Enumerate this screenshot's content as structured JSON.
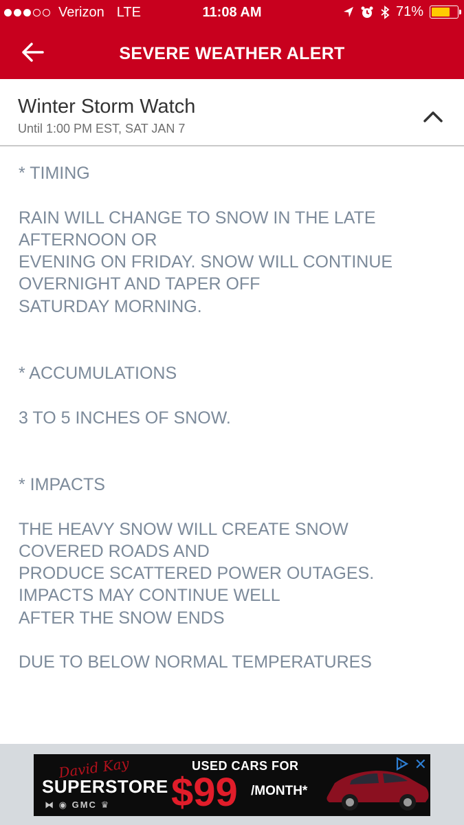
{
  "status_bar": {
    "carrier": "Verizon",
    "network": "LTE",
    "time": "11:08 AM",
    "battery": "71%",
    "battery_level": 0.71,
    "signal_bars_filled": 3,
    "signal_bars_total": 5
  },
  "nav": {
    "title": "SEVERE WEATHER ALERT",
    "back_icon": "arrow-left-icon"
  },
  "alert": {
    "title": "Winter Storm Watch",
    "subtitle": "Until 1:00 PM EST, SAT JAN 7",
    "toggle_icon": "chevron-up-icon"
  },
  "body": {
    "timing_heading": "* TIMING",
    "timing_lines": [
      "RAIN WILL CHANGE TO SNOW IN THE LATE",
      "AFTERNOON OR",
      "EVENING ON FRIDAY. SNOW WILL CONTINUE",
      "OVERNIGHT AND TAPER OFF",
      "SATURDAY MORNING."
    ],
    "accumulations_heading": "* ACCUMULATIONS",
    "accumulations_text": "3 TO 5 INCHES OF SNOW.",
    "impacts_heading": "* IMPACTS",
    "impacts_lines": [
      "THE HEAVY SNOW WILL CREATE SNOW",
      "COVERED ROADS AND",
      "PRODUCE SCATTERED POWER OUTAGES.",
      "IMPACTS MAY CONTINUE WELL",
      "AFTER THE SNOW ENDS"
    ],
    "temperatures_text": "DUE TO BELOW NORMAL TEMPERATURES"
  },
  "ad": {
    "script_text": "David Kay",
    "superstore": "SUPERSTORE",
    "brands": "GMC",
    "headline": "USED CARS FOR",
    "price": "$99",
    "per": "/MONTH*",
    "close": "✕"
  },
  "colors": {
    "header_red": "#c8001e",
    "body_text": "#7c8a9a",
    "battery_yellow": "#ffcc00",
    "ad_background": "#d6dade"
  }
}
